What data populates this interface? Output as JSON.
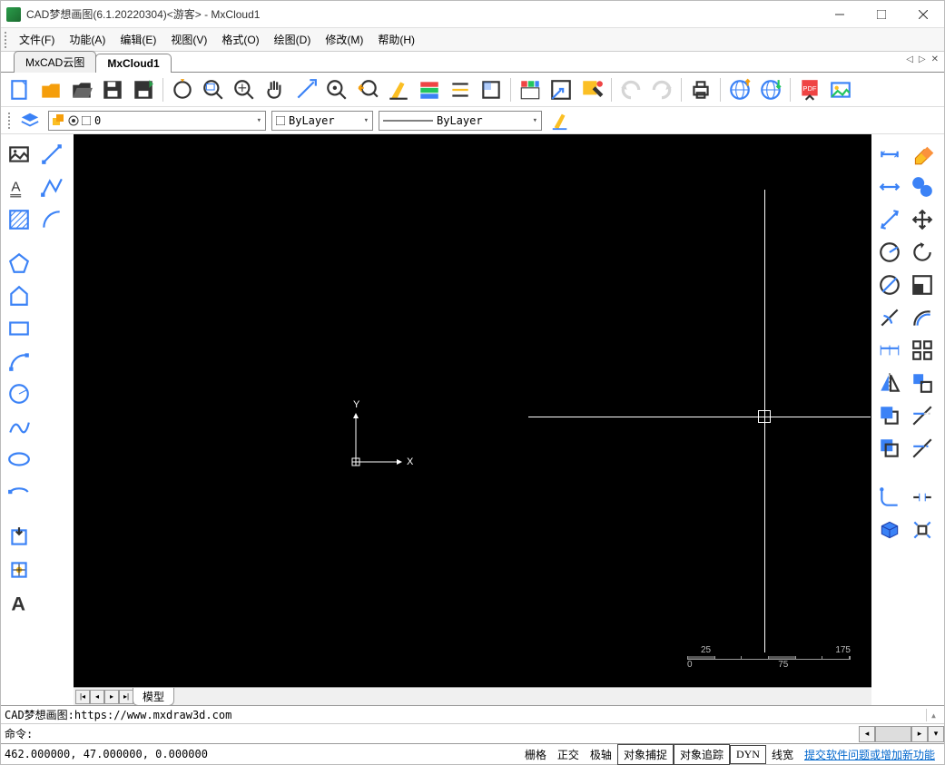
{
  "window": {
    "title": "CAD梦想画图(6.1.20220304)<游客> - MxCloud1"
  },
  "menu": {
    "file": "文件(F)",
    "function": "功能(A)",
    "edit": "编辑(E)",
    "view": "视图(V)",
    "format": "格式(O)",
    "draw": "绘图(D)",
    "modify": "修改(M)",
    "help": "帮助(H)"
  },
  "tabs": {
    "t1": "MxCAD云图",
    "t2": "MxCloud1"
  },
  "layerbar": {
    "layer": "0",
    "linetype": "ByLayer",
    "lineweight": "ByLayer"
  },
  "canvas": {
    "axis_x": "X",
    "axis_y": "Y",
    "ruler_labels": {
      "a": "0",
      "b": "25",
      "c": "75",
      "d": "175"
    }
  },
  "modeltab": {
    "label": "模型"
  },
  "command": {
    "log": "CAD梦想画图:https://www.mxdraw3d.com",
    "prompt": "命令:"
  },
  "status": {
    "coords": "462.000000, 47.000000, 0.000000",
    "grid": "栅格",
    "ortho": "正交",
    "polar": "极轴",
    "osnap": "对象捕捉",
    "otrack": "对象追踪",
    "dyn": "DYN",
    "lw": "线宽",
    "feedback": "提交软件问题或增加新功能"
  }
}
